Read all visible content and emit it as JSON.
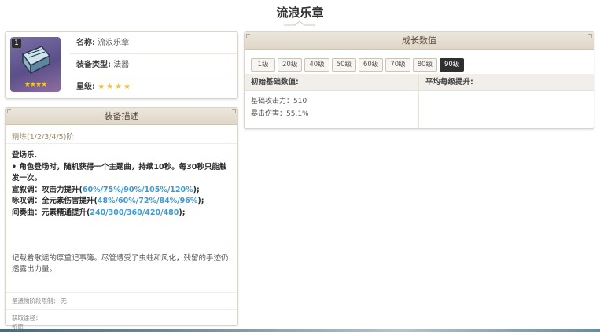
{
  "page": {
    "title": "流浪乐章"
  },
  "info": {
    "level_badge": "1",
    "icon_stars": "★★★★",
    "name_key": "名称:",
    "name_value": "流浪乐章",
    "type_key": "装备类型:",
    "type_value": "法器",
    "rarity_key": "星级:",
    "rarity_value": "★★★★",
    "icon": "catalyst-book-icon"
  },
  "description": {
    "header": "装备描述",
    "refine": "精炼(1/2/3/4/5)阶",
    "effect_title": "登场乐.",
    "effect_line1": "• 角色登场时，随机获得一个主题曲，持续10秒。每30秒只能触发一次。",
    "effect_line2_key": "宣叙调：攻击力提升(",
    "effect_line2_val": "60%/75%/90%/105%/120%",
    "effect_line2_end": ");",
    "effect_line3_key": "咏叹调：全元素伤害提升(",
    "effect_line3_val": "48%/60%/72%/84%/96%",
    "effect_line3_end": ");",
    "effect_line4_key": "间奏曲：元素精通提升(",
    "effect_line4_val": "240/300/360/420/480",
    "effect_line4_end": ");",
    "lore": "记载着歌谣的厚重记事簿。尽管遭受了虫蛀和风化，残留的手迹仍透露出力量。",
    "ascension_key": "圣遗物阶段限制：",
    "ascension_value": "无",
    "source_key": "获取途径：",
    "source_value": "祈愿"
  },
  "stats": {
    "header": "成长数值",
    "levels": [
      "1级",
      "20级",
      "40级",
      "50级",
      "60级",
      "70级",
      "80级",
      "90级"
    ],
    "active_level": "90级",
    "base_header": "初始基础数值:",
    "growth_header": "平均每级提升:",
    "base_atk_label": "基础攻击力：",
    "base_atk_value": "510",
    "crit_dmg_label": "暴击伤害：",
    "crit_dmg_value": "55.1%"
  },
  "colors": {
    "accent": "#3b9bd3",
    "star": "#f0c23a",
    "header_bg": "#e4ddd0",
    "active_level_bg": "#2f2f2f"
  }
}
